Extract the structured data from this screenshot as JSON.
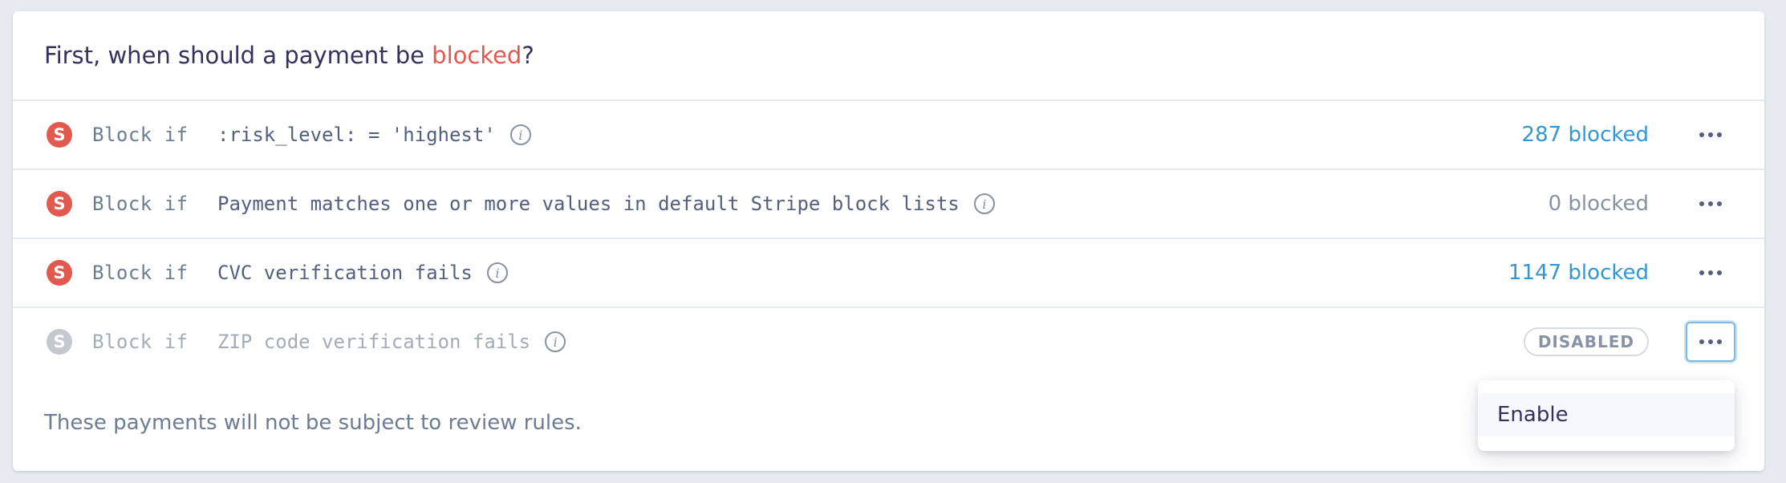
{
  "header": {
    "title_prefix": "First, when should a payment be ",
    "title_highlight": "blocked",
    "title_suffix": "?"
  },
  "rules": [
    {
      "badge": "S",
      "keyword": "Block if",
      "condition": ":risk_level: = 'highest'",
      "info": "i",
      "count": "287 blocked",
      "state": "enabled"
    },
    {
      "badge": "S",
      "keyword": "Block if",
      "condition": "Payment matches one or more values in default Stripe block lists",
      "info": "i",
      "count": "0 blocked",
      "state": "enabled"
    },
    {
      "badge": "S",
      "keyword": "Block if",
      "condition": "CVC verification fails",
      "info": "i",
      "count": "1147 blocked",
      "state": "enabled"
    },
    {
      "badge": "S",
      "keyword": "Block if",
      "condition": "ZIP code verification fails",
      "info": "i",
      "status": "DISABLED",
      "state": "disabled"
    }
  ],
  "footer": {
    "text": "These payments will not be subject to review rules."
  },
  "menu": {
    "items": [
      "Enable"
    ]
  },
  "colors": {
    "accent_red": "#e25950",
    "link_blue": "#3297d3",
    "text_dark": "#32325d",
    "background": "#e6ebf1"
  }
}
